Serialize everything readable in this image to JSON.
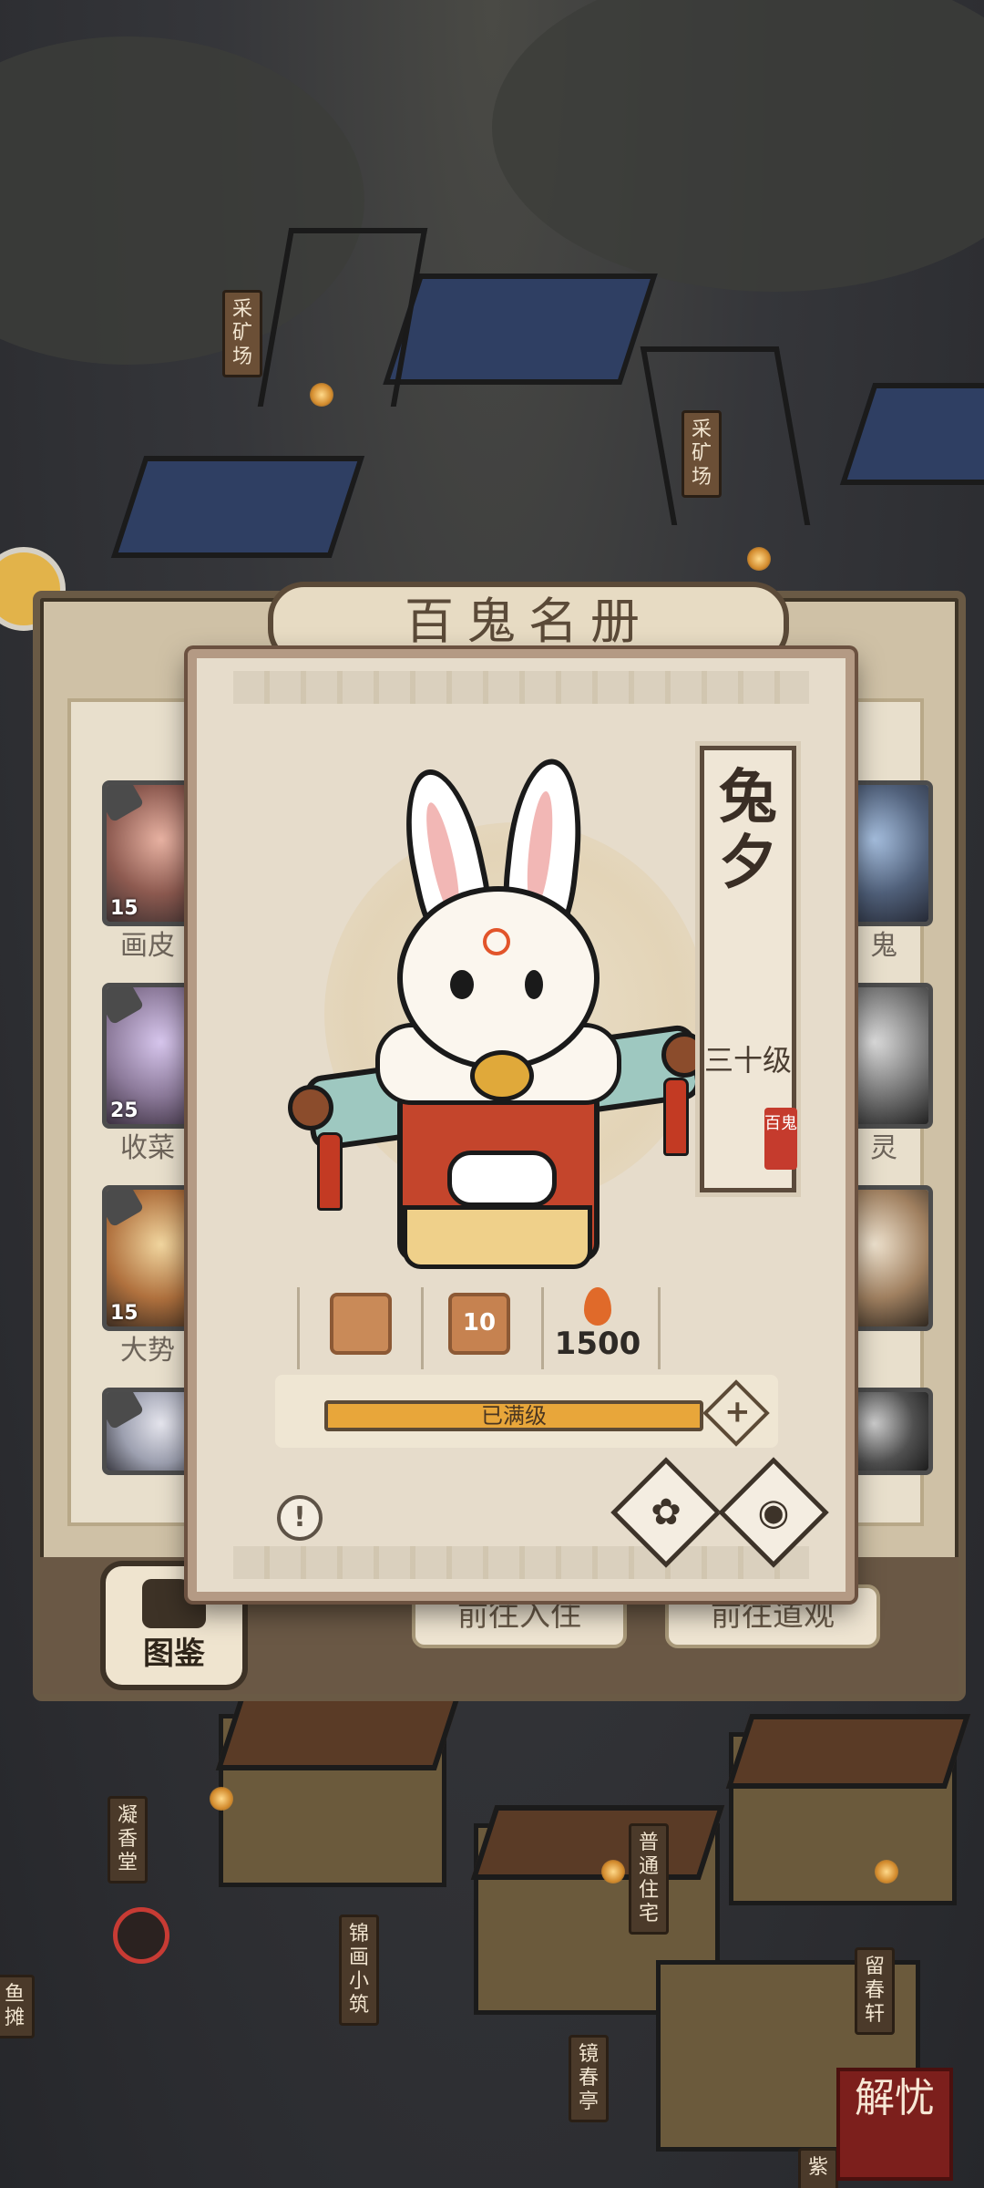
{
  "scene": {
    "signs_top": [
      "采矿场",
      "采矿场"
    ],
    "signs_bottom": [
      "凝香堂",
      "锦画小筑",
      "镜春亭",
      "普通住宅",
      "留春轩",
      "鱼摊",
      "紫"
    ]
  },
  "book": {
    "title": "百鬼名册",
    "cards_left": [
      {
        "name": "画皮",
        "level": "15"
      },
      {
        "name": "收菜",
        "level": "25"
      },
      {
        "name": "大势",
        "level": "15"
      }
    ],
    "cards_right_names": [
      "鬼",
      "灵"
    ],
    "tujian_label": "图鉴",
    "btn_checkin": "前往入住",
    "btn_temple": "前往道观"
  },
  "character": {
    "name": "兔夕",
    "level": "三十级",
    "seal": "百鬼",
    "stats": [
      {
        "icon": "talisman-icon",
        "value": ""
      },
      {
        "icon": "level-badge-icon",
        "value": "10"
      },
      {
        "icon": "flame-icon",
        "value": "1500"
      }
    ],
    "progress_label": "已满级",
    "progress_fraction": 1.0,
    "plus": "+",
    "info": "!"
  },
  "corner_stamp": "解忧",
  "colors": {
    "accent": "#c4452c",
    "panel": "#e6dccb",
    "bar": "#e8a63a"
  }
}
